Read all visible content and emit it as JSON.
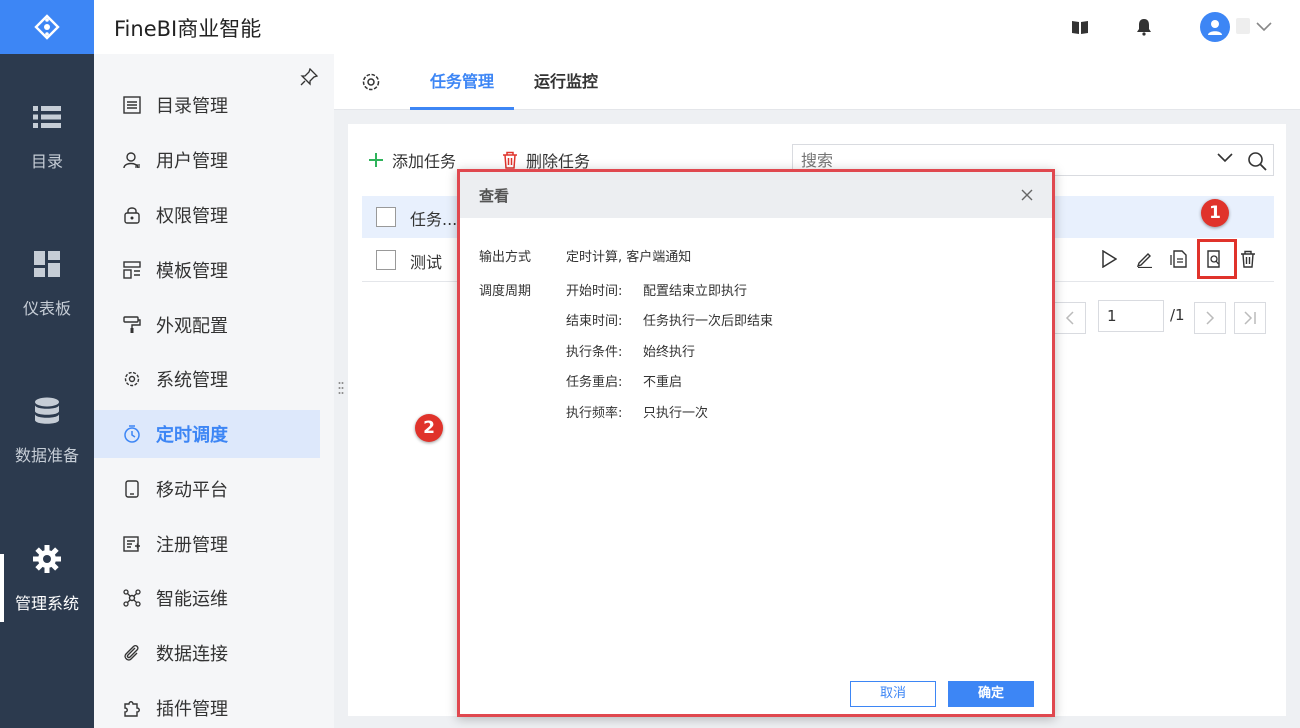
{
  "app": {
    "title": "FineBI商业智能"
  },
  "leftnav": {
    "items": [
      {
        "label": "目录",
        "icon": "list-icon"
      },
      {
        "label": "仪表板",
        "icon": "dashboard-icon"
      },
      {
        "label": "数据准备",
        "icon": "database-icon"
      },
      {
        "label": "管理系统",
        "icon": "gear-icon",
        "active": true
      }
    ]
  },
  "sidebar": {
    "items": [
      {
        "label": "目录管理",
        "icon": "catalog-icon"
      },
      {
        "label": "用户管理",
        "icon": "user-icon"
      },
      {
        "label": "权限管理",
        "icon": "lock-icon"
      },
      {
        "label": "模板管理",
        "icon": "template-icon"
      },
      {
        "label": "外观配置",
        "icon": "paint-roller-icon"
      },
      {
        "label": "系统管理",
        "icon": "gear-icon"
      },
      {
        "label": "定时调度",
        "icon": "timer-icon",
        "active": true
      },
      {
        "label": "移动平台",
        "icon": "mobile-icon"
      },
      {
        "label": "注册管理",
        "icon": "register-icon"
      },
      {
        "label": "智能运维",
        "icon": "network-icon"
      },
      {
        "label": "数据连接",
        "icon": "paperclip-icon"
      },
      {
        "label": "插件管理",
        "icon": "puzzle-icon"
      }
    ]
  },
  "tabs": [
    {
      "label": "任务管理",
      "active": true
    },
    {
      "label": "运行监控"
    }
  ],
  "toolbar": {
    "add_label": "添加任务",
    "delete_label": "删除任务"
  },
  "search": {
    "placeholder": "搜索"
  },
  "table": {
    "header": "任务...",
    "rows": [
      {
        "name": "测试"
      }
    ]
  },
  "pager": {
    "current": "1",
    "total": "/1"
  },
  "markers": {
    "one": "1",
    "two": "2"
  },
  "dialog": {
    "title": "查看",
    "output_label": "输出方式",
    "output_value": "定时计算, 客户端通知",
    "schedule_label": "调度周期",
    "schedule": [
      {
        "key": "开始时间:",
        "value": "配置结束立即执行"
      },
      {
        "key": "结束时间:",
        "value": "任务执行一次后即结束"
      },
      {
        "key": "执行条件:",
        "value": "始终执行"
      },
      {
        "key": "任务重启:",
        "value": "不重启"
      },
      {
        "key": "执行频率:",
        "value": "只执行一次"
      }
    ],
    "cancel_label": "取消",
    "ok_label": "确定"
  },
  "colors": {
    "accent": "#3d86f5",
    "nav_bg": "#2c3a4e",
    "annotation": "#e0332b"
  }
}
